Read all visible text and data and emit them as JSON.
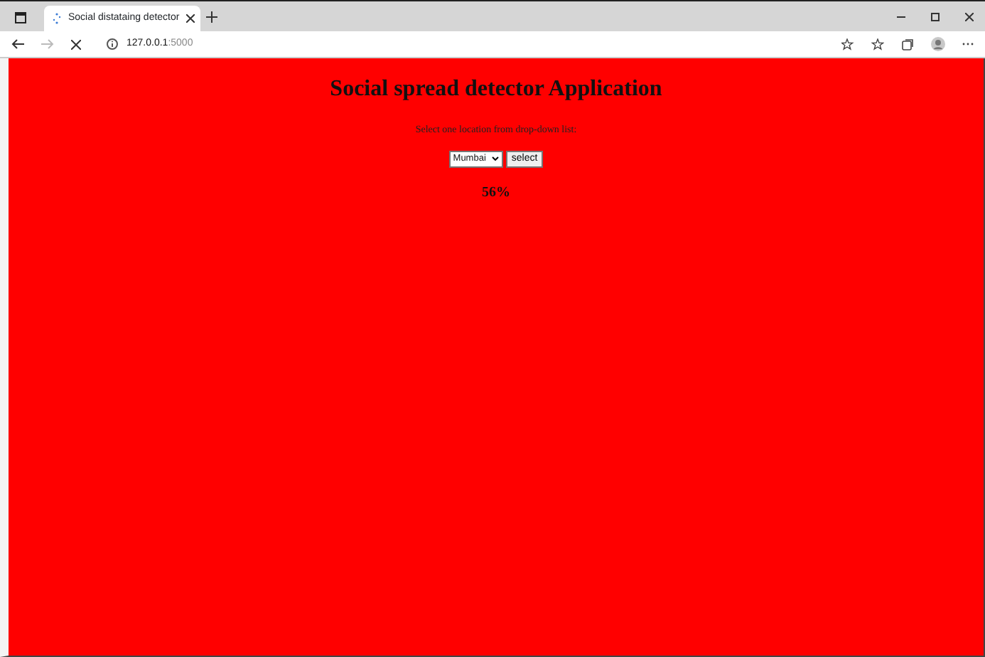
{
  "browser": {
    "tab": {
      "title": "Social distataing detector",
      "loading": true
    },
    "address": {
      "host": "127.0.0.1",
      "port": ":5000"
    },
    "forward_enabled": false
  },
  "page": {
    "heading": "Social spread detector Application",
    "instruction": "Select one location from drop-down list:",
    "location": {
      "value": "Mumbai"
    },
    "button": "select",
    "result": "56%"
  }
}
